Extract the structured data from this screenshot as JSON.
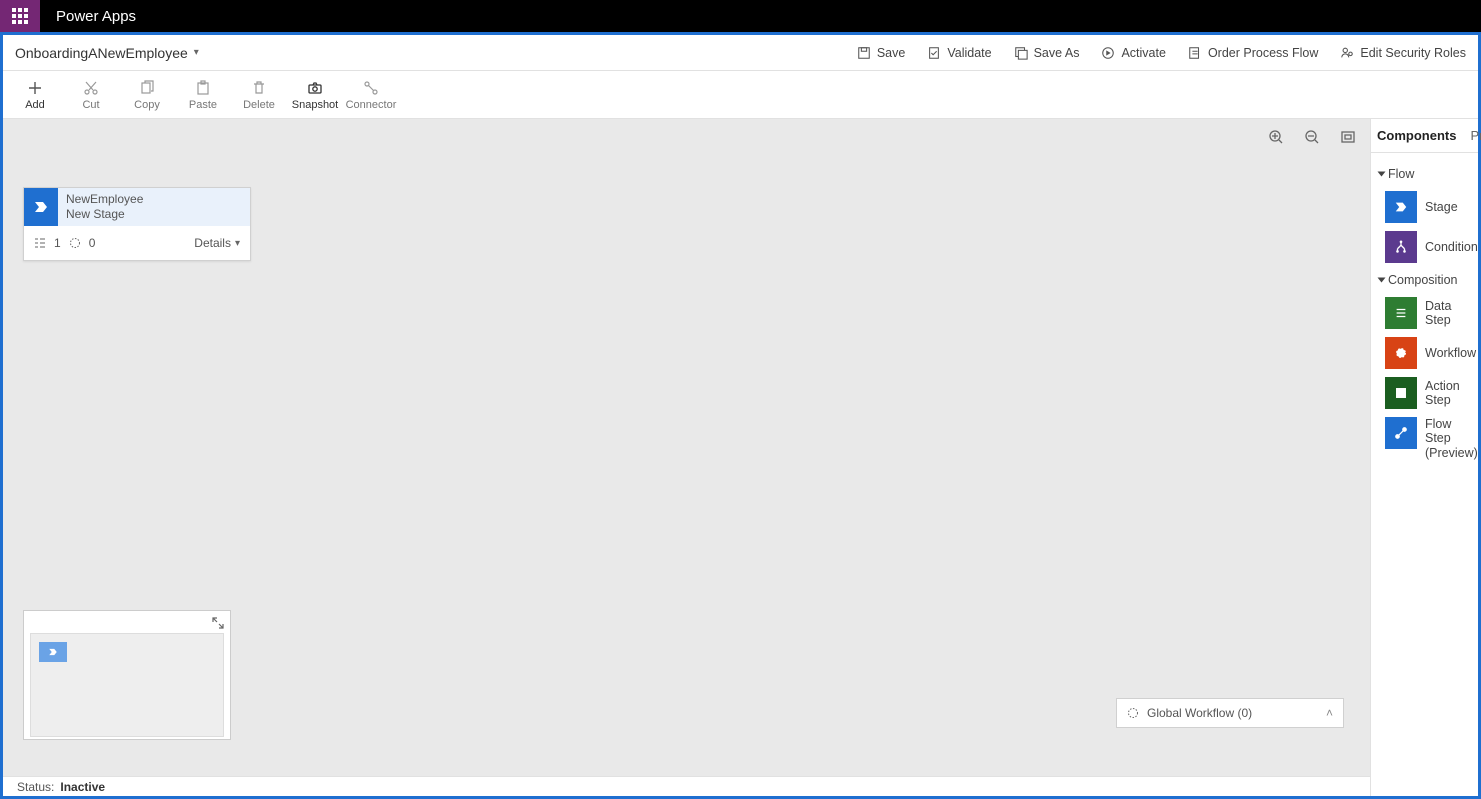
{
  "titlebar": {
    "app_name": "Power Apps"
  },
  "header": {
    "flow_name": "OnboardingANewEmployee",
    "actions": {
      "save": "Save",
      "validate": "Validate",
      "save_as": "Save As",
      "activate": "Activate",
      "order": "Order Process Flow",
      "security": "Edit Security Roles"
    }
  },
  "ribbon": {
    "add": "Add",
    "cut": "Cut",
    "copy": "Copy",
    "paste": "Paste",
    "delete": "Delete",
    "snapshot": "Snapshot",
    "connector": "Connector"
  },
  "stage": {
    "entity": "NewEmployee",
    "name": "New Stage",
    "steps": "1",
    "workflows": "0",
    "details": "Details"
  },
  "global_workflow": {
    "label": "Global Workflow (0)"
  },
  "status": {
    "label": "Status:",
    "value": "Inactive"
  },
  "side": {
    "tabs": {
      "components": "Components",
      "properties": "Pro"
    },
    "flow_group": "Flow",
    "composition_group": "Composition",
    "items": {
      "stage": "Stage",
      "condition": "Condition",
      "data_step": "Data Step",
      "workflow": "Workflow",
      "action_step": "Action Step",
      "flow_step_l1": "Flow Step",
      "flow_step_l2": "(Preview)"
    }
  }
}
